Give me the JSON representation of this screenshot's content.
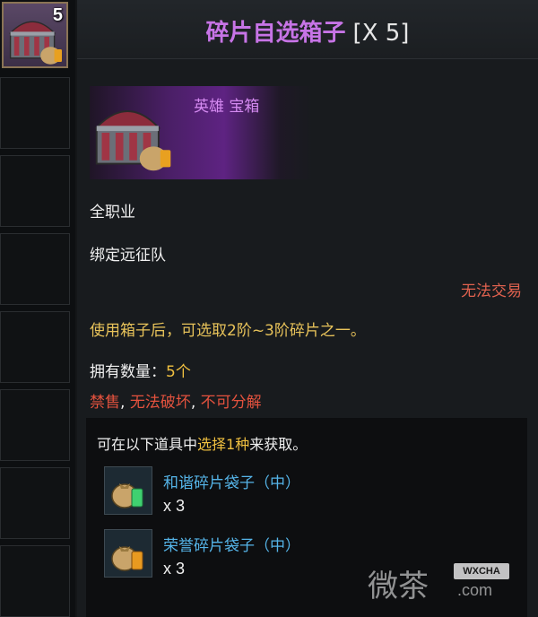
{
  "inventory": {
    "active_count": "5"
  },
  "tooltip": {
    "title": "碎片自选箱子",
    "title_qty": "[X 5]",
    "hero_label": "英雄 宝箱",
    "class_restriction": "全职业",
    "binding": "绑定远征队",
    "trade_status": "无法交易",
    "description": "使用箱子后，可选取2阶~3阶碎片之一。",
    "owned_label": "拥有数量：",
    "owned_value": "5个",
    "restrictions": {
      "no_sell": "禁售",
      "sep1": ", ",
      "no_destroy": "无法破坏",
      "sep2": ", ",
      "no_dismantle": "不可分解"
    },
    "colors": {
      "title": "#c774e6",
      "hero": "#d58af1",
      "desc": "#e8c35a",
      "red": "#e4523e",
      "option_name": "#55b4e8",
      "highlight": "#f0c040"
    }
  },
  "choose": {
    "prefix": "可在以下道具中",
    "highlight": "选择1种",
    "suffix": "来获取。",
    "options": [
      {
        "name": "和谐碎片袋子（中）",
        "qty": "x 3",
        "icon": "harmony-shard-bag-icon"
      },
      {
        "name": "荣誉碎片袋子（中）",
        "qty": "x 3",
        "icon": "honor-shard-bag-icon"
      }
    ]
  },
  "watermark": {
    "text": "微茶",
    "badge": "WXCHA",
    "domain": ".com"
  }
}
